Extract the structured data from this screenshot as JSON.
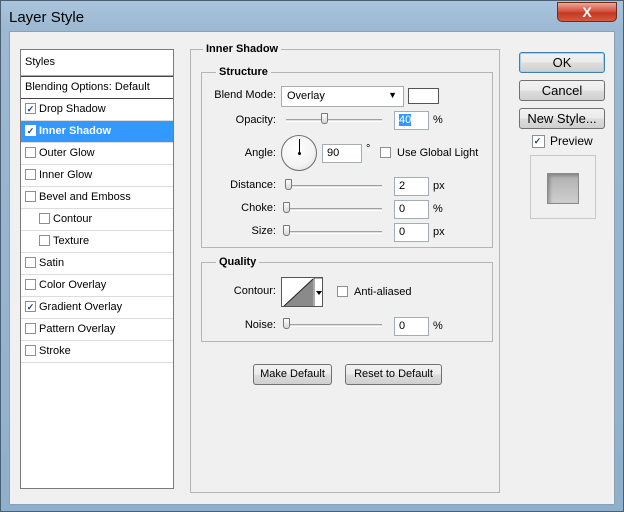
{
  "window": {
    "title": "Layer Style",
    "close_label": "X"
  },
  "styles_list": {
    "header": "Styles",
    "blending_options": "Blending Options: Default",
    "items": [
      {
        "label": "Drop Shadow",
        "checked": true,
        "selected": false,
        "indent": false
      },
      {
        "label": "Inner Shadow",
        "checked": true,
        "selected": true,
        "indent": false
      },
      {
        "label": "Outer Glow",
        "checked": false,
        "selected": false,
        "indent": false
      },
      {
        "label": "Inner Glow",
        "checked": false,
        "selected": false,
        "indent": false
      },
      {
        "label": "Bevel and Emboss",
        "checked": false,
        "selected": false,
        "indent": false
      },
      {
        "label": "Contour",
        "checked": false,
        "selected": false,
        "indent": true
      },
      {
        "label": "Texture",
        "checked": false,
        "selected": false,
        "indent": true
      },
      {
        "label": "Satin",
        "checked": false,
        "selected": false,
        "indent": false
      },
      {
        "label": "Color Overlay",
        "checked": false,
        "selected": false,
        "indent": false
      },
      {
        "label": "Gradient Overlay",
        "checked": true,
        "selected": false,
        "indent": false
      },
      {
        "label": "Pattern Overlay",
        "checked": false,
        "selected": false,
        "indent": false
      },
      {
        "label": "Stroke",
        "checked": false,
        "selected": false,
        "indent": false
      }
    ]
  },
  "panel": {
    "title": "Inner Shadow",
    "structure": {
      "title": "Structure",
      "blend_mode_label": "Blend Mode:",
      "blend_mode_value": "Overlay",
      "opacity_label": "Opacity:",
      "opacity_value": "40",
      "opacity_unit": "%",
      "opacity_fraction": 0.4,
      "angle_label": "Angle:",
      "angle_value": "90",
      "angle_unit": "°",
      "use_global_light_label": "Use Global Light",
      "use_global_light_checked": false,
      "distance_label": "Distance:",
      "distance_value": "2",
      "distance_unit": "px",
      "choke_label": "Choke:",
      "choke_value": "0",
      "choke_unit": "%",
      "size_label": "Size:",
      "size_value": "0",
      "size_unit": "px"
    },
    "quality": {
      "title": "Quality",
      "contour_label": "Contour:",
      "anti_aliased_label": "Anti-aliased",
      "anti_aliased_checked": false,
      "noise_label": "Noise:",
      "noise_value": "0",
      "noise_unit": "%"
    },
    "make_default_label": "Make Default",
    "reset_default_label": "Reset to Default"
  },
  "buttons": {
    "ok": "OK",
    "cancel": "Cancel",
    "new_style": "New Style...",
    "preview_label": "Preview",
    "preview_checked": true
  },
  "colors": {
    "selection": "#3399ff",
    "dialog_bg": "#f0f0f0",
    "close_button": "#c23a23"
  }
}
